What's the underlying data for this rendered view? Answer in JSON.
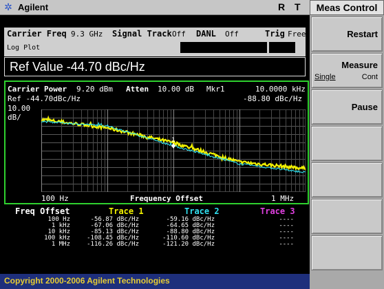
{
  "top_bar": {
    "logo_icon": "agilent-spark-icon",
    "brand": "Agilent",
    "indicator_r": "R",
    "indicator_t": "T"
  },
  "info": {
    "carrier_freq_label": "Carrier Freq",
    "carrier_freq_value": "9.3 GHz",
    "signal_track_label": "Signal Track",
    "signal_track_value": "Off",
    "danl_label": "DANL",
    "danl_value": "Off",
    "trig_label": "Trig",
    "trig_value": "Free",
    "plot_type": "Log Plot"
  },
  "entry": {
    "text": "Ref Value -44.70 dBc/Hz"
  },
  "graph": {
    "carrier_power_label": "Carrier Power",
    "carrier_power_value": "9.20 dBm",
    "atten_label": "Atten",
    "atten_value": "10.00 dB",
    "mkr_label": "Mkr1",
    "mkr_freq": "10.0000 kHz",
    "ref_text": "Ref -44.70dBc/Hz",
    "mkr_value": "-88.80 dBc/Hz",
    "scale_value": "10.00",
    "scale_unit": "dB/",
    "x_start": "100 Hz",
    "x_label": "Frequency Offset",
    "x_end": "1 MHz",
    "marker_label": "1",
    "trace_colors": {
      "trace1": "#f2f200",
      "trace2": "#30e0f0",
      "trace3": "#e040e0"
    }
  },
  "chart_data": {
    "type": "line",
    "title": "",
    "xlabel": "Frequency Offset",
    "ylabel": "dBc/Hz",
    "x_scale": "log",
    "x": [
      100,
      1000,
      10000,
      100000,
      1000000
    ],
    "xlim": [
      100,
      1000000
    ],
    "ylim": [
      -144.7,
      -44.7
    ],
    "y_per_div": 10,
    "grid": true,
    "series": [
      {
        "name": "Trace 1",
        "values": [
          -56.87,
          -67.06,
          -85.13,
          -108.45,
          -116.26
        ]
      },
      {
        "name": "Trace 2",
        "values": [
          -59.16,
          -64.65,
          -88.8,
          -110.6,
          -121.2
        ]
      }
    ]
  },
  "table": {
    "header_offset": "Freq Offset",
    "header_trace1": "Trace 1",
    "header_trace2": "Trace 2",
    "header_trace3": "Trace 3",
    "rows": [
      {
        "offset": "100 Hz",
        "t1": "-56.87 dBc/Hz",
        "t2": "-59.16 dBc/Hz",
        "t3": "----"
      },
      {
        "offset": "1 kHz",
        "t1": "-67.06 dBc/Hz",
        "t2": "-64.65 dBc/Hz",
        "t3": "----"
      },
      {
        "offset": "10 kHz",
        "t1": "-85.13 dBc/Hz",
        "t2": "-88.80 dBc/Hz",
        "t3": "----"
      },
      {
        "offset": "100 kHz",
        "t1": "-108.45 dBc/Hz",
        "t2": "-110.60 dBc/Hz",
        "t3": "----"
      },
      {
        "offset": "1 MHz",
        "t1": "-116.26 dBc/Hz",
        "t2": "-121.20 dBc/Hz",
        "t3": "----"
      }
    ]
  },
  "footer": {
    "copyright": "Copyright 2000-2006 Agilent Technologies"
  },
  "softkeys": {
    "menu_title": "Meas Control",
    "restart": "Restart",
    "measure": "Measure",
    "measure_single": "Single",
    "measure_cont": "Cont",
    "pause": "Pause"
  }
}
